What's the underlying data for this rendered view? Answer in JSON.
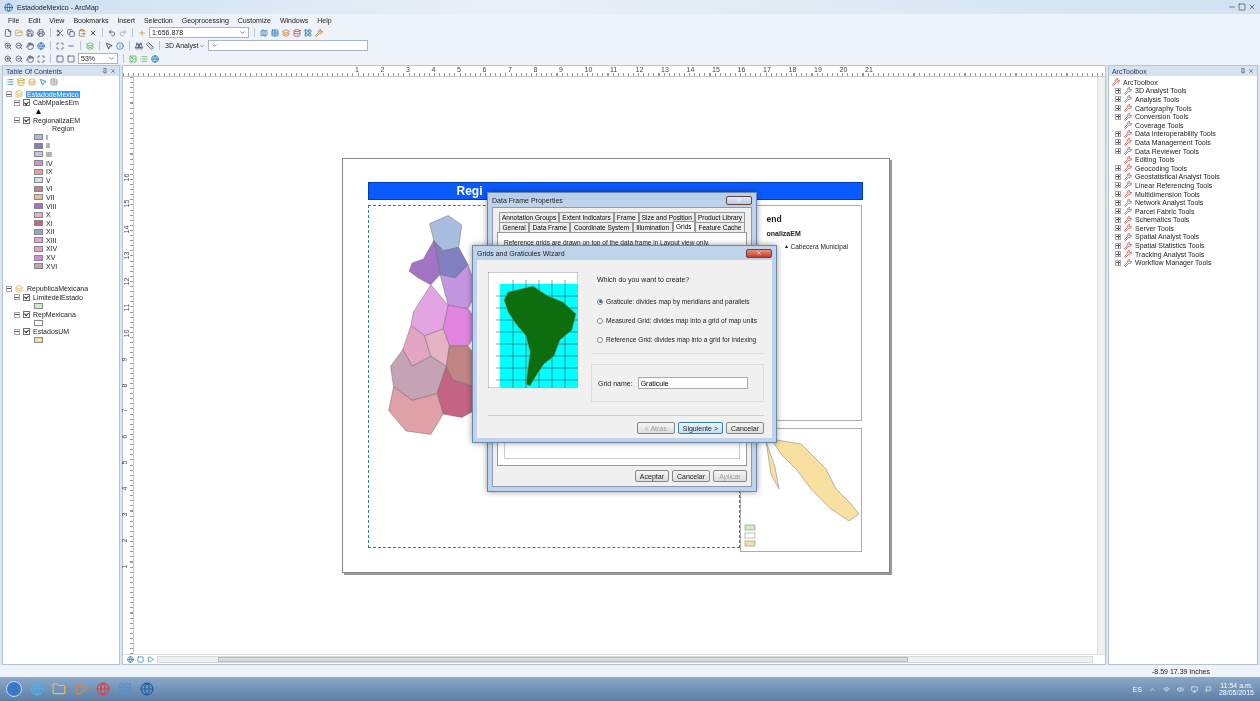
{
  "window": {
    "title": "EstadodeMexico - ArcMap"
  },
  "menu": [
    "File",
    "Edit",
    "View",
    "Bookmarks",
    "Insert",
    "Selection",
    "Geoprocessing",
    "Customize",
    "Windows",
    "Help"
  ],
  "toolbar": {
    "scale": "1:656.878",
    "analyst_menu": "3D Analyst",
    "zoom": "53%"
  },
  "toc": {
    "title": "Table Of Contents",
    "groups": [
      {
        "name": "EstadodeMexico",
        "selected": true,
        "expanded": true,
        "children": [
          {
            "name": "CabMpalesEm",
            "checked": true,
            "expanded": true,
            "kind": "point"
          },
          {
            "name": "RegionalizaEM",
            "checked": true,
            "expanded": true,
            "kind": "classes",
            "field": "Region",
            "classes": [
              {
                "label": "I",
                "color": "#a9bde0"
              },
              {
                "label": "II",
                "color": "#8080c0"
              },
              {
                "label": "III",
                "color": "#c4c4ea"
              },
              {
                "label": "IV",
                "color": "#c496e0"
              },
              {
                "label": "IX",
                "color": "#e0a0a8"
              },
              {
                "label": "V",
                "color": "#cce4f2"
              },
              {
                "label": "VI",
                "color": "#c08484"
              },
              {
                "label": "VII",
                "color": "#e2c494"
              },
              {
                "label": "VIII",
                "color": "#a474c4"
              },
              {
                "label": "X",
                "color": "#e4b4c4"
              },
              {
                "label": "XI",
                "color": "#c46484"
              },
              {
                "label": "XII",
                "color": "#94a4cc"
              },
              {
                "label": "XIII",
                "color": "#e4a4e4"
              },
              {
                "label": "XIV",
                "color": "#e4a4c4"
              },
              {
                "label": "XV",
                "color": "#e084e0"
              },
              {
                "label": "XVI",
                "color": "#c4a4b4"
              }
            ]
          }
        ]
      },
      {
        "name": "RepublicaMexicana",
        "selected": false,
        "expanded": true,
        "children": [
          {
            "name": "LimitedelEstado",
            "checked": true,
            "expanded": true,
            "kind": "fill",
            "color": "#c8f0c0"
          },
          {
            "name": "RepMexicana",
            "checked": true,
            "expanded": true,
            "kind": "fill",
            "color": "#ffffff"
          },
          {
            "name": "EstadosUM",
            "checked": true,
            "expanded": true,
            "kind": "fill",
            "color": "#f8e0a0"
          }
        ]
      }
    ]
  },
  "layout": {
    "horizontal_ruler": [
      "1",
      "2",
      "3",
      "4",
      "5",
      "6",
      "7",
      "8",
      "9",
      "10",
      "11",
      "12",
      "13",
      "14",
      "15",
      "16",
      "17",
      "18",
      "19",
      "20",
      "21"
    ],
    "vertical_ruler": [
      "16",
      "15",
      "14",
      "13",
      "12",
      "11",
      "10",
      "9",
      "8",
      "7",
      "6",
      "5",
      "4",
      "3",
      "2",
      "1"
    ],
    "title": "Regi",
    "legend": {
      "heading": "end",
      "layer": "onalizaEM",
      "point_label": "Cabecera Municipal"
    }
  },
  "toolbox": {
    "title": "ArcToolbox",
    "root": "ArcToolbox",
    "items": [
      {
        "name": "3D Analyst Tools",
        "expandable": true
      },
      {
        "name": "Analysis Tools",
        "expandable": true
      },
      {
        "name": "Cartography Tools",
        "expandable": true
      },
      {
        "name": "Conversion Tools",
        "expandable": true
      },
      {
        "name": "Coverage Tools",
        "expandable": false
      },
      {
        "name": "Data Interoperability Tools",
        "expandable": true
      },
      {
        "name": "Data Management Tools",
        "expandable": true
      },
      {
        "name": "Data Reviewer Tools",
        "expandable": true
      },
      {
        "name": "Editing Tools",
        "expandable": false
      },
      {
        "name": "Geocoding Tools",
        "expandable": true
      },
      {
        "name": "Geostatistical Analyst Tools",
        "expandable": true
      },
      {
        "name": "Linear Referencing Tools",
        "expandable": true
      },
      {
        "name": "Multidimension Tools",
        "expandable": true
      },
      {
        "name": "Network Analyst Tools",
        "expandable": true
      },
      {
        "name": "Parcel Fabric Tools",
        "expandable": true
      },
      {
        "name": "Schematics Tools",
        "expandable": true
      },
      {
        "name": "Server Tools",
        "expandable": true
      },
      {
        "name": "Spatial Analyst Tools",
        "expandable": true
      },
      {
        "name": "Spatial Statistics Tools",
        "expandable": true
      },
      {
        "name": "Tracking Analyst Tools",
        "expandable": true
      },
      {
        "name": "Workflow Manager Tools",
        "expandable": true
      }
    ]
  },
  "data_frame_dialog": {
    "title": "Data Frame Properties",
    "tab_rows": [
      [
        {
          "label": "Annotation Groups",
          "selected": false
        },
        {
          "label": "Extent Indicators",
          "selected": false
        },
        {
          "label": "Frame",
          "selected": false
        },
        {
          "label": "Size and Position",
          "selected": false
        },
        {
          "label": "Product Library",
          "selected": false
        }
      ],
      [
        {
          "label": "General",
          "selected": false
        },
        {
          "label": "Data Frame",
          "selected": false
        },
        {
          "label": "Coordinate System",
          "selected": false
        },
        {
          "label": "Illumination",
          "selected": false
        },
        {
          "label": "Grids",
          "selected": true
        },
        {
          "label": "Feature Cache",
          "selected": false
        }
      ]
    ],
    "note": "Reference grids are drawn on top of the data frame in Layout view only.",
    "buttons": [
      {
        "label": "Aceptar",
        "disabled": false
      },
      {
        "label": "Cancelar",
        "disabled": false
      },
      {
        "label": "Aplicar",
        "disabled": true
      }
    ]
  },
  "wizard": {
    "title": "Grids and Graticules Wizard",
    "question": "Which do you want to create?",
    "options": [
      {
        "label": "Graticule: divides map by meridians and parallels",
        "selected": true
      },
      {
        "label": "Measured Grid: divides map into a grid of map units",
        "selected": false
      },
      {
        "label": "Reference Grid: divides map into a grid for indexing",
        "selected": false
      }
    ],
    "grid_name_label": "Grid name:",
    "grid_name": "Graticule",
    "buttons": [
      {
        "label": "< Atrás",
        "disabled": true,
        "default": false
      },
      {
        "label": "Siguiente >",
        "disabled": false,
        "default": true
      },
      {
        "label": "Cancelar",
        "disabled": false,
        "default": false
      }
    ]
  },
  "status": {
    "coordinates": "-8.59  17.39 Inches"
  },
  "taskbar": {
    "language": "ES",
    "time": "11:54 a.m.",
    "date": "28/05/2015"
  }
}
